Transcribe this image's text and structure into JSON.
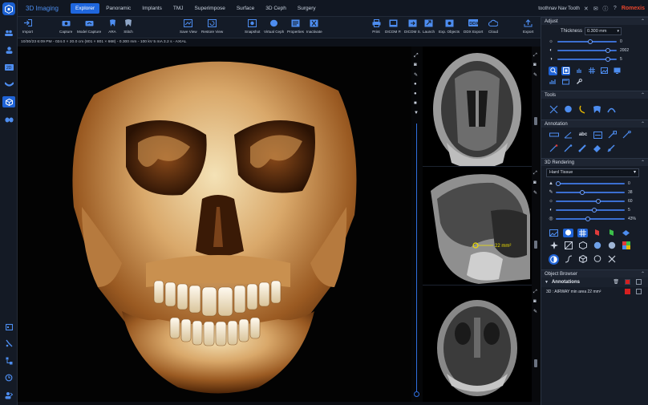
{
  "app": {
    "name": "3D Imaging"
  },
  "nav": {
    "tabs": [
      "Explorer",
      "Panoramic",
      "Implants",
      "TMJ",
      "Superimpose",
      "Surface",
      "3D Ceph",
      "Surgery"
    ],
    "active": 0
  },
  "user": {
    "name": "toothnav Nav Tooth",
    "brand": "Romexis"
  },
  "toolbar": {
    "import": "Import",
    "capture": "Capture",
    "model_capture": "Model Capture",
    "ara": "ARA",
    "stitch": "Stitch",
    "save_view": "Save View",
    "restore_view": "Restore View",
    "snapshot": "Snapshot",
    "virtual_ceph": "Virtual Ceph",
    "properties": "Properties",
    "inactivate": "Inactivate",
    "print": "Print",
    "dicom_p": "DICOM P.",
    "dicom_s": "DICOM S.",
    "launch": "Launch",
    "exp_objects": "Exp. Objects",
    "ddx_export": "DDX Export",
    "cloud": "Cloud",
    "export": "Export"
  },
  "info": {
    "text": "10/30/23 6:09 PM - 024.0 × 20.0 cm (801 × 801 × 668) - 0.300 mm - 100 kV 5 mA 3.2 s - AXIAL"
  },
  "measurement": {
    "text": "22 mm²"
  },
  "panel": {
    "adjust": {
      "title": "Adjust",
      "thickness_label": "Thickness",
      "thickness_value": "0.300 mm",
      "sliders": [
        {
          "icon": "sun",
          "value": "0"
        },
        {
          "icon": "contrast",
          "value": "2002"
        },
        {
          "icon": "gamma",
          "value": "5"
        }
      ]
    },
    "tools": {
      "title": "Tools"
    },
    "annotation": {
      "title": "Annotation",
      "abc": "abc"
    },
    "rendering": {
      "title": "3D Rendering",
      "preset": "Hard Tissue",
      "sliders": [
        {
          "value": "0"
        },
        {
          "value": "38"
        },
        {
          "value": "60"
        },
        {
          "value": "5"
        },
        {
          "value": "43%"
        }
      ]
    },
    "browser": {
      "title": "Object Browser",
      "group": "Annotations",
      "item": "3D : AIRWAY min area 22 mm²"
    }
  },
  "colors": {
    "accent": "#1f63d6",
    "brand": "#e8452c",
    "item_red": "#d61f1f"
  }
}
